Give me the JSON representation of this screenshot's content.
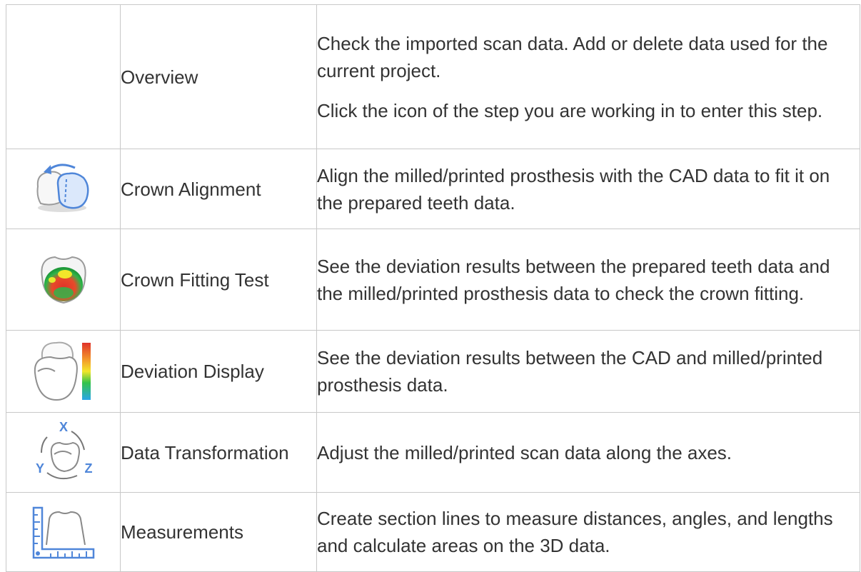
{
  "rows": [
    {
      "icon": "none",
      "name": "Overview",
      "description": [
        "Check the imported scan data. Add or delete data used for the current project.",
        "Click the icon of the step you are working in to enter this step."
      ]
    },
    {
      "icon": "crown-alignment-icon",
      "name": "Crown Alignment",
      "description": [
        "Align the milled/printed prosthesis with the CAD data to fit it on the prepared teeth data."
      ]
    },
    {
      "icon": "crown-fitting-test-icon",
      "name": "Crown Fitting Test",
      "description": [
        "See the deviation results between the prepared teeth data and the milled/printed prosthesis data to check the crown fitting."
      ]
    },
    {
      "icon": "deviation-display-icon",
      "name": "Deviation Display",
      "description": [
        "See the deviation results between the CAD and milled/printed prosthesis data."
      ]
    },
    {
      "icon": "data-transformation-icon",
      "name": "Data Transformation",
      "axis_labels": {
        "x": "X",
        "y": "Y",
        "z": "Z"
      },
      "description": [
        "Adjust the milled/printed scan data along the axes."
      ]
    },
    {
      "icon": "measurements-icon",
      "name": "Measurements",
      "description": [
        "Create section lines to measure distances, angles, and lengths and calculate areas on the 3D data."
      ]
    }
  ],
  "colors": {
    "accent_blue": "#4f86d9",
    "border": "#c8c8c8",
    "text": "#333333"
  }
}
